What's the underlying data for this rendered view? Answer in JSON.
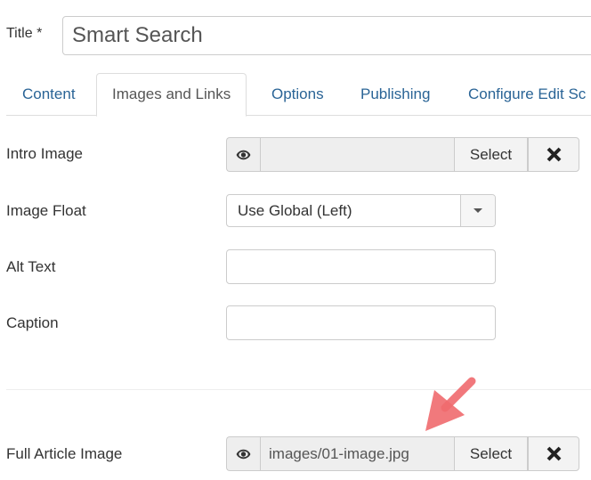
{
  "title_field": {
    "label": "Title *",
    "value": "Smart Search"
  },
  "tabs": [
    {
      "label": "Content",
      "active": false
    },
    {
      "label": "Images and Links",
      "active": true
    },
    {
      "label": "Options",
      "active": false
    },
    {
      "label": "Publishing",
      "active": false
    },
    {
      "label": "Configure Edit Sc",
      "active": false
    }
  ],
  "fields": {
    "intro_image": {
      "label": "Intro Image",
      "value": "",
      "select_label": "Select",
      "preview_icon": "eye-icon",
      "clear_icon": "close-icon"
    },
    "image_float": {
      "label": "Image Float",
      "value": "Use Global (Left)"
    },
    "alt_text": {
      "label": "Alt Text",
      "value": ""
    },
    "caption": {
      "label": "Caption",
      "value": ""
    },
    "full_article_image": {
      "label": "Full Article Image",
      "value": "images/01-image.jpg",
      "select_label": "Select",
      "preview_icon": "eye-icon",
      "clear_icon": "close-icon"
    }
  },
  "annotation": {
    "type": "arrow",
    "color": "#f06a6e"
  },
  "colors": {
    "tab_link": "#2a6496",
    "border": "#cccccc",
    "input_readonly_bg": "#eeeeee"
  }
}
